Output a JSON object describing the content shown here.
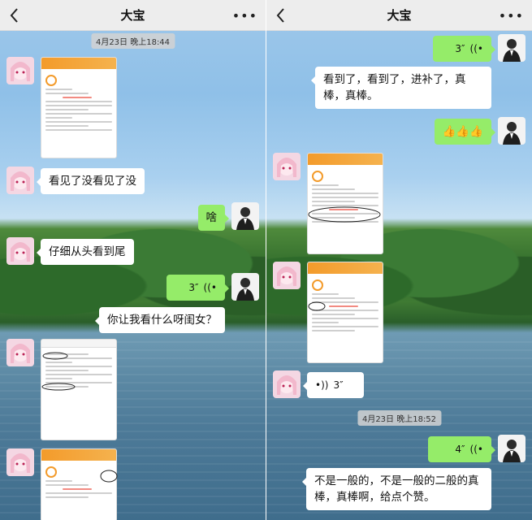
{
  "chat": {
    "title": "大宝"
  },
  "left": {
    "timestamp": "4月23日 晚上18:44",
    "messages": [
      {
        "text": "看见了没看见了没"
      },
      {
        "text": "啥"
      },
      {
        "text": "仔细从头看到尾"
      },
      {
        "voice": "3″"
      },
      {
        "text": "你让我看什么呀闺女？"
      }
    ]
  },
  "right": {
    "timestamp": "4月23日 晚上18:52",
    "messages": [
      {
        "voice": "3″"
      },
      {
        "text": "看到了，看到了，进补了，真棒，真棒。"
      },
      {
        "text": "👍👍👍"
      },
      {
        "voice": "3″"
      },
      {
        "voice": "4″"
      },
      {
        "text": "不是一般的，不是一般的二般的真棒，真棒啊，给点个赞。"
      }
    ]
  },
  "colors": {
    "header": "#ededed",
    "green_bubble": "#95ec69",
    "white_bubble": "#ffffff",
    "doc_orange": "#f39b2b"
  },
  "icons": {
    "back": "chevron-left-icon",
    "more": "more-dots-icon",
    "voice": "voice-wave-icon"
  }
}
